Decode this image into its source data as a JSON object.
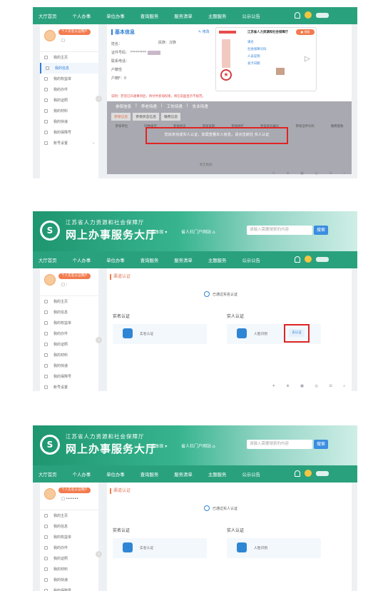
{
  "nav": {
    "items": [
      "大厅首页",
      "个人办事",
      "单位办事",
      "查询服务",
      "服务清单",
      "主题服务",
      "公示公告"
    ]
  },
  "banner": {
    "line1": "江苏省人力资源和社会保障厅",
    "line2": "网上办事服务大厅",
    "region": "☆省本级 ▾",
    "site": "省人社门户网站 ⌂",
    "search_placeholder": "请输入需要搜索的内容",
    "search_button": "搜索"
  },
  "sidebar": {
    "tag": "个人实名认证用户",
    "items": [
      "我的主页",
      "我的信息",
      "我的权益单",
      "我的办件",
      "我的证照",
      "我的材料",
      "我的快递",
      "我的保障号",
      "账号设置"
    ]
  },
  "shot1": {
    "title": "基本信息",
    "edit": "✎ 修改",
    "fields": [
      "姓名：",
      "证件号码：",
      "联系电话：",
      "户籍性",
      "户籍F：0"
    ],
    "nation": "民族：汉族",
    "card_title": "江苏省人力资源和社会保障厅",
    "apply_btn": "● 领取",
    "card_links": [
      "请名",
      "社会保障号码",
      "人员证明",
      "发卡日期"
    ],
    "notice": "说明：若您已开通事项后，将付件查询权限，将在前面显示不规范。",
    "tabs": [
      "参保信息",
      "养老待遇",
      "工伤待遇",
      "失业待遇"
    ],
    "subtabs": [
      "参保信息",
      "参保状态信息",
      "缴费信息"
    ],
    "table_headers": [
      "参保单位",
      "险种类型",
      "参保状态",
      "参保日期",
      "参保地区",
      "参保单位编号",
      "参保证件号码",
      "缴费基数"
    ],
    "alert": "您尚未完成实人认证，如需查看本人信息，请点击前往 实人认证",
    "no_data": "暂无数据"
  },
  "shot2": {
    "section": "渠道认证",
    "verified": "已通过实名认证",
    "left_title": "实名认证",
    "left_card": "实名认证",
    "right_title": "实人认证",
    "right_card": "人脸识别",
    "cert_btn": "去认证"
  },
  "shot3": {
    "section": "渠道认证",
    "verified": "已通过实人认证",
    "left_title": "实名认证",
    "left_card": "实名认证",
    "right_title": "实人认证",
    "right_card": "人脸识别"
  }
}
